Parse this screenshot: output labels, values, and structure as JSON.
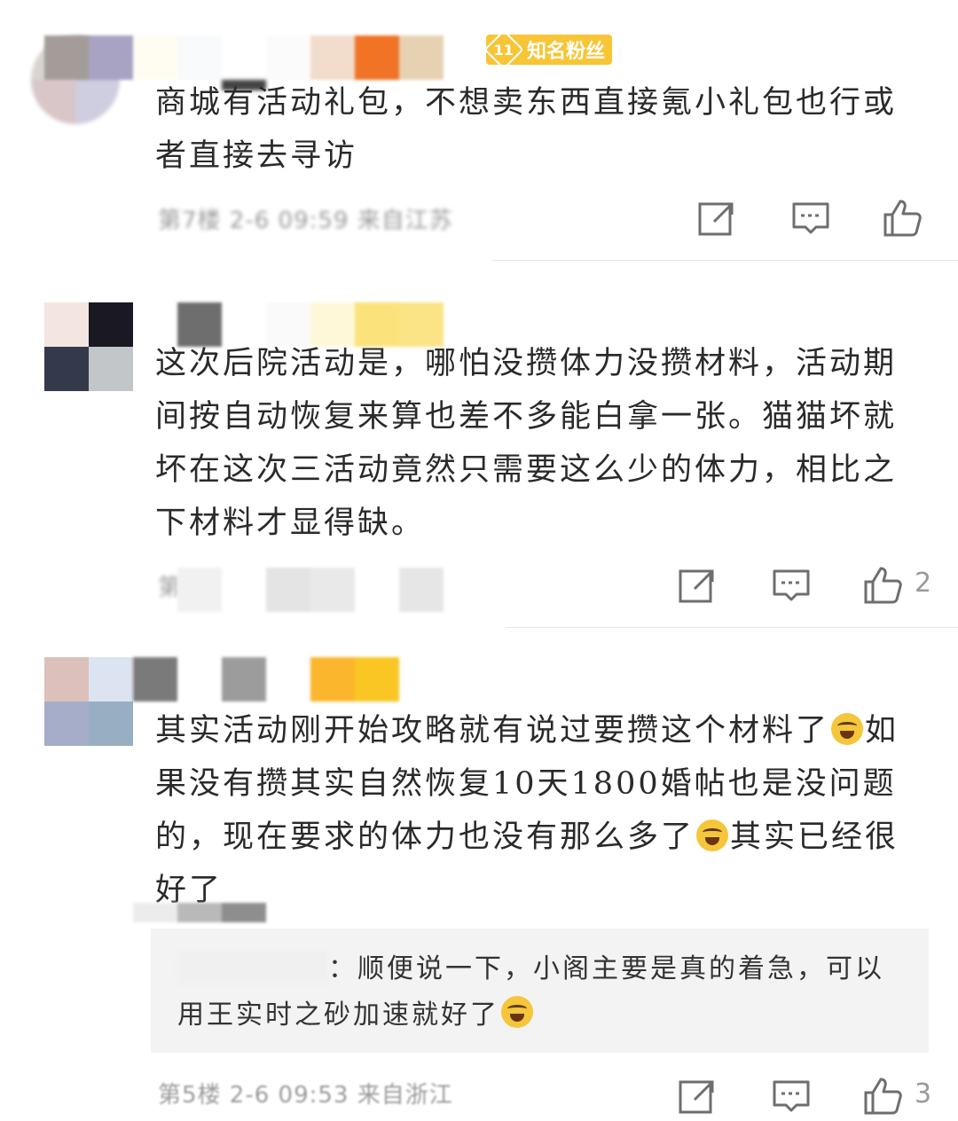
{
  "comments": [
    {
      "text": "商城有活动礼包，不想卖东西直接氪小礼包也行或者直接去寻访",
      "badge_level": "11",
      "badge_label": "知名粉丝",
      "meta": "第7楼 2-6 09:59 来自江苏",
      "likes": ""
    },
    {
      "text": "这次后院活动是，哪怕没攒体力没攒材料，活动期间按自动恢复来算也差不多能白拿一张。猫猫坏就坏在这次三活动竟然只需要这么少的体力，相比之下材料才显得缺。",
      "meta": "第6楼",
      "likes": "2"
    },
    {
      "text_before_emoji_1": "其实活动刚开始攻略就有说过要攒这个材料了",
      "text_middle": "如果没有攒其实自然恢复10天1800婚帖也是没问题的，现在要求的体力也没有那么多了",
      "text_after_emoji_2": "其实已经很好了",
      "reply": {
        "text_before_emoji": "：顺便说一下，小阁主要是真的着急，可以用王实时之砂加速就好了"
      },
      "meta": "第5楼 2-6 09:53 来自浙江",
      "likes": "3"
    }
  ],
  "icons": {
    "share": "share-icon",
    "comment": "comment-icon",
    "like": "thumbs-up-icon",
    "emoji": "laugh-cry-emoji"
  },
  "colors": {
    "badge": "#f7c536",
    "meta": "#9a9a9a",
    "icon": "#6e6e6e",
    "reply_bg": "#f3f3f3"
  }
}
